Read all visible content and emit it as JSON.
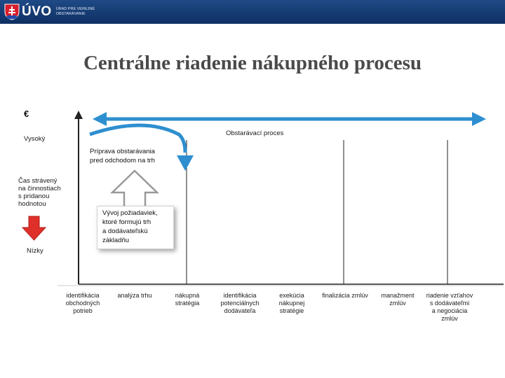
{
  "header": {
    "logo_text": "ÚVO",
    "logo_subtitle": "ÚRAD PRE VEREJNÉ OBSTARÁVANIE"
  },
  "title": "Centrálne riadenie nákupného procesu",
  "axis": {
    "currency_symbol": "€",
    "high_label": "Vysoký",
    "time_label_lines": [
      "Čas strávený",
      "na činnostiach",
      "s pridanou",
      "hodnotou"
    ],
    "low_label": "Nízky"
  },
  "process_label": "Obstarávací proces",
  "boxes": {
    "preparation_lines": [
      "Príprava obstarávania",
      "pred odchodom na trh"
    ],
    "development_lines": [
      "Vývoj požiadaviek,",
      "ktoré formujú trh",
      "a dodávateľskú",
      "základňu"
    ]
  },
  "steps": [
    {
      "lines": [
        "identifikácia",
        "obchodných",
        "potrieb"
      ]
    },
    {
      "lines": [
        "analýza trhu"
      ]
    },
    {
      "lines": [
        "nákupná",
        "stratégia"
      ]
    },
    {
      "lines": [
        "identifikácia",
        "potenciálnych",
        "dodávateľa"
      ]
    },
    {
      "lines": [
        "exekúcia",
        "nákupnej",
        "stratégie"
      ]
    },
    {
      "lines": [
        "finalizácia zmlúv"
      ]
    },
    {
      "lines": [
        "manažment",
        "zmlúv"
      ]
    },
    {
      "lines": [
        "riadenie vzťahov",
        "s dodávateľmi",
        "a negociácia",
        "zmlúv"
      ]
    }
  ],
  "colors": {
    "header": "#1a3f78",
    "arrow_blue": "#2e8fd0",
    "arrow_red": "#e0302a",
    "arrow_gray": "#9a9a9a",
    "axis": "#222222"
  }
}
